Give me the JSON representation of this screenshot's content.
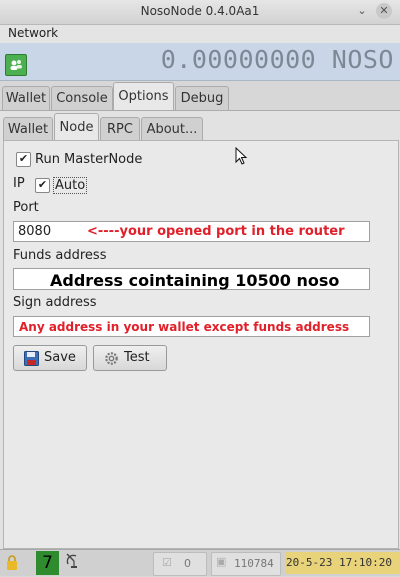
{
  "window": {
    "title": "NosoNode 0.4.0Aa1",
    "controls": [
      "chevron-down-icon",
      "close-icon"
    ]
  },
  "menu": {
    "network": "Network"
  },
  "balance": {
    "value": "0.00000000 NOSO",
    "color": "#7d8894"
  },
  "main_tabs": [
    {
      "label": "Wallet",
      "active": false
    },
    {
      "label": "Console",
      "active": false
    },
    {
      "label": "Options",
      "active": true
    },
    {
      "label": "Debug",
      "active": false
    }
  ],
  "sub_tabs": [
    {
      "label": "Wallet",
      "active": false
    },
    {
      "label": "Node",
      "active": true
    },
    {
      "label": "RPC",
      "active": false
    },
    {
      "label": "About...",
      "active": false
    }
  ],
  "node": {
    "run_masternode_label": "Run MasterNode",
    "run_masternode_checked": true,
    "ip_label": "IP",
    "auto_label": "Auto",
    "auto_checked": true,
    "port_label": "Port",
    "port_value": "8080",
    "port_hint": "<----your opened port in the router",
    "funds_label": "Funds address",
    "funds_value": "Address cointaining 10500 noso",
    "sign_label": "Sign address",
    "sign_value": "Any address in your wallet except funds address",
    "save_button": "Save",
    "test_button": "Test"
  },
  "annotation_color": "#e0202a",
  "status": {
    "peers": "7",
    "pending": "0",
    "block": "110784",
    "datetime": "20-5-23 17:10:20",
    "peers_color": "#2e8b2e"
  }
}
